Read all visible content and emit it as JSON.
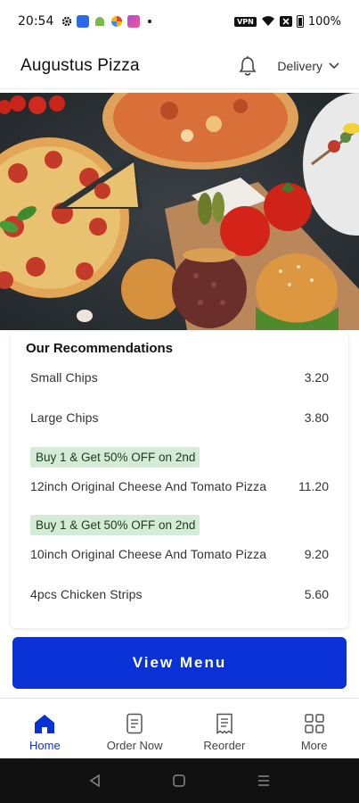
{
  "status_bar": {
    "time": "20:54",
    "battery": "100%",
    "vpn_label": "VPN"
  },
  "header": {
    "title": "Augustus Pizza",
    "delivery_label": "Delivery"
  },
  "recommendations": {
    "title": "Our Recommendations",
    "items": [
      {
        "name": "Small Chips",
        "price": "3.20",
        "promo": ""
      },
      {
        "name": "Large Chips",
        "price": "3.80",
        "promo": ""
      },
      {
        "name": "12inch Original Cheese And Tomato Pizza",
        "price": "11.20",
        "promo": "Buy 1 & Get 50% OFF on 2nd"
      },
      {
        "name": "10inch Original Cheese And Tomato Pizza",
        "price": "9.20",
        "promo": "Buy 1 & Get 50% OFF on 2nd"
      },
      {
        "name": "4pcs Chicken Strips",
        "price": "5.60",
        "promo": ""
      }
    ]
  },
  "view_menu_label": "View Menu",
  "bottom_nav": {
    "items": [
      {
        "label": "Home",
        "icon": "home-icon",
        "active": true
      },
      {
        "label": "Order Now",
        "icon": "order-icon",
        "active": false
      },
      {
        "label": "Reorder",
        "icon": "receipt-icon",
        "active": false
      },
      {
        "label": "More",
        "icon": "grid-icon",
        "active": false
      }
    ]
  },
  "colors": {
    "primary": "#0a31d6",
    "promo_bg": "#d4ecd6"
  }
}
